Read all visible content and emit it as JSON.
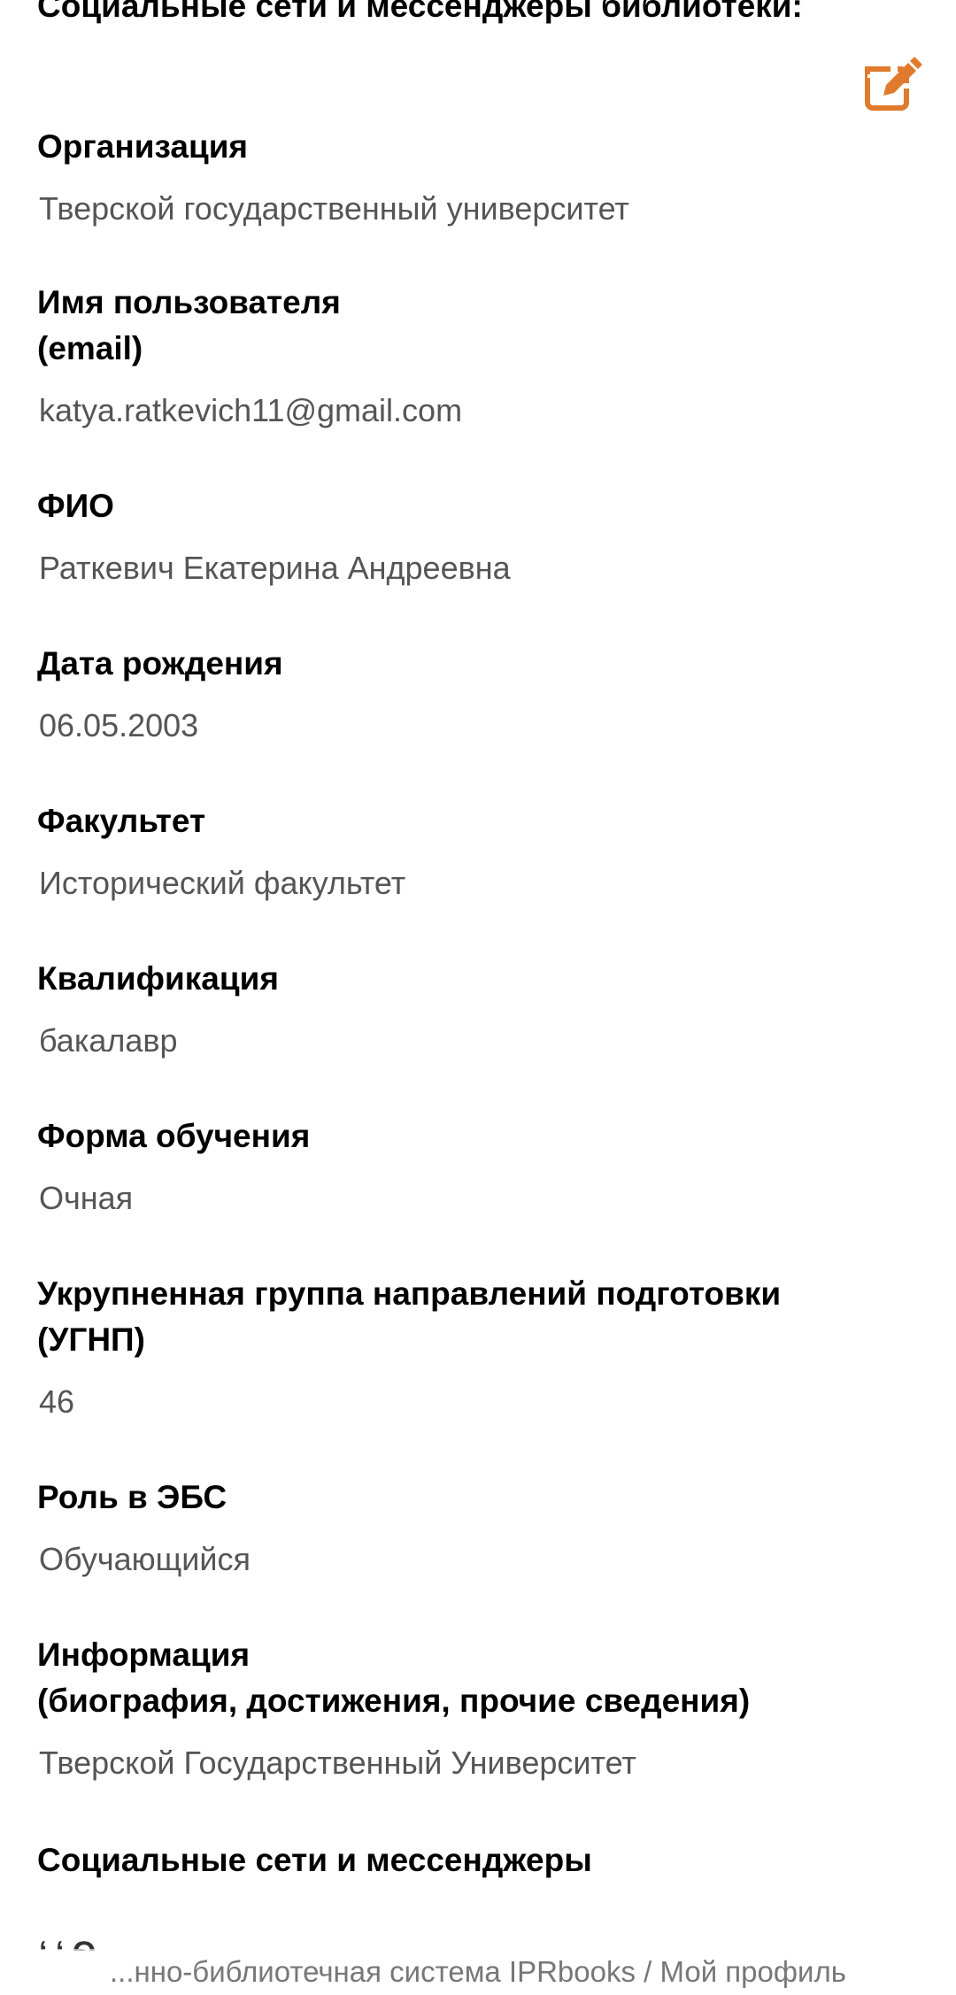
{
  "page": {
    "social_heading_top": "Социальные сети и мессенджеры библиотеки:",
    "edit_icon": "edit-icon",
    "accent_color": "#E07B2E"
  },
  "profile": {
    "organization": {
      "label": "Организация",
      "value": "Тверской государственный университет"
    },
    "username": {
      "label_line1": "Имя пользователя",
      "label_line2": "(email)",
      "value": "katya.ratkevich11@gmail.com"
    },
    "full_name": {
      "label": "ФИО",
      "value": "Раткевич Екатерина Андреевна"
    },
    "birth_date": {
      "label": "Дата рождения",
      "value": "06.05.2003"
    },
    "faculty": {
      "label": "Факультет",
      "value": "Исторический факультет"
    },
    "qualification": {
      "label": "Квалификация",
      "value": "бакалавр"
    },
    "study_form": {
      "label": "Форма обучения",
      "value": "Очная"
    },
    "ugnp": {
      "label_line1": "Укрупненная группа направлений подготовки",
      "label_line2": "(УГНП)",
      "value": "46"
    },
    "role": {
      "label": "Роль в ЭБС",
      "value": "Обучающийся"
    },
    "info": {
      "label_line1": "Информация",
      "label_line2": "(биография, достижения, прочие сведения)",
      "value": "Тверской Государственный Университет"
    },
    "social": {
      "label": "Социальные сети и мессенджеры"
    }
  },
  "footer": {
    "breadcrumb": "...нно-библиотечная система IPRbooks / Мой профиль",
    "cut_text": "ʻ ʻ Ѳ"
  }
}
